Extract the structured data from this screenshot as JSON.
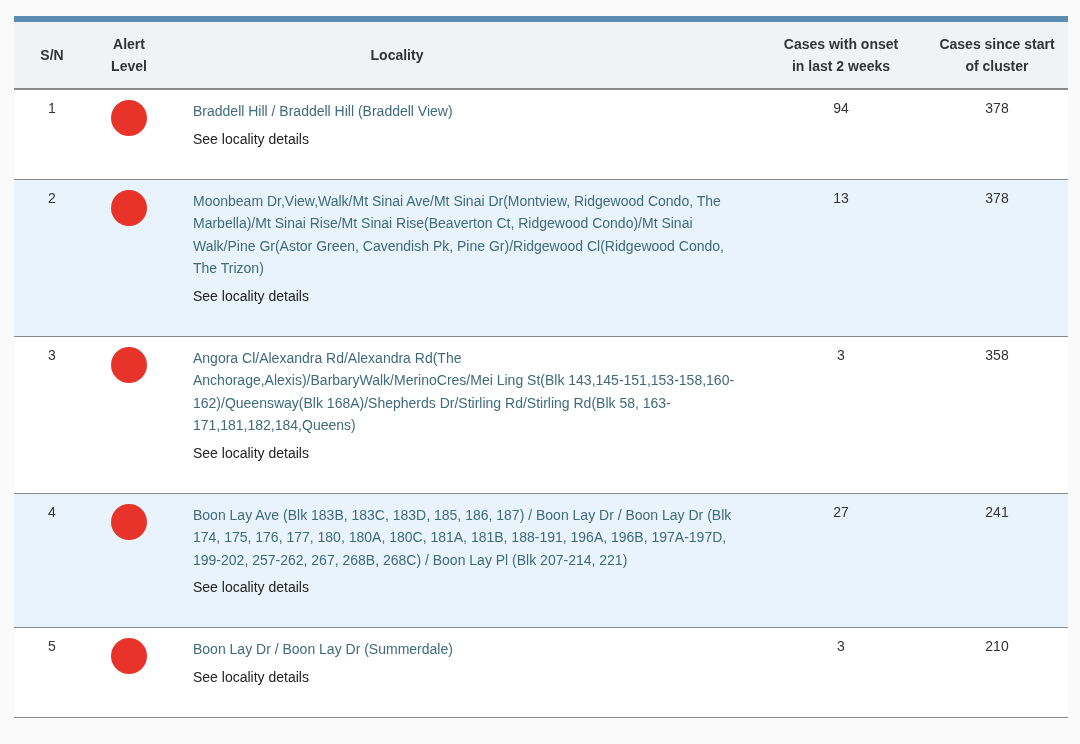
{
  "table": {
    "columns": [
      {
        "label": "S/N"
      },
      {
        "label": "Alert Level"
      },
      {
        "label": "Locality"
      },
      {
        "label": "Cases with onset in last 2 weeks"
      },
      {
        "label": "Cases since start of cluster"
      }
    ],
    "rows": [
      {
        "sn": "1",
        "color": "#e8332a",
        "locality": "Braddell Hill / Braddell Hill (Braddell View)",
        "link": "See locality details",
        "cases_2_weeks": "94",
        "cases_total": "378"
      },
      {
        "sn": "2",
        "color": "#e8332a",
        "locality": "Moonbeam Dr,View,Walk/Mt Sinai Ave/Mt Sinai Dr(Montview, Ridgewood Condo, The Marbella)/Mt Sinai Rise/Mt Sinai Rise(Beaverton Ct, Ridgewood Condo)/Mt Sinai Walk/Pine Gr(Astor Green, Cavendish Pk, Pine Gr)/Ridgewood Cl(Ridgewood Condo, The Trizon)",
        "link": "See locality details",
        "cases_2_weeks": "13",
        "cases_total": "378"
      },
      {
        "sn": "3",
        "color": "#e8332a",
        "locality": "Angora Cl/Alexandra Rd/Alexandra Rd(The Anchorage,Alexis)/BarbaryWalk/MerinoCres/Mei Ling St(Blk 143,145-151,153-158,160-162)/Queensway(Blk 168A)/Shepherds Dr/Stirling Rd/Stirling Rd(Blk 58, 163-171,181,182,184,Queens)",
        "link": "See locality details",
        "cases_2_weeks": "3",
        "cases_total": "358"
      },
      {
        "sn": "4",
        "color": "#e8332a",
        "locality": "Boon Lay Ave (Blk 183B, 183C, 183D, 185, 186, 187) / Boon Lay Dr / Boon Lay Dr (Blk 174, 175, 176, 177, 180, 180A, 180C, 181A, 181B, 188-191, 196A, 196B, 197A-197D, 199-202, 257-262, 267, 268B, 268C) / Boon Lay Pl (Blk 207-214, 221)",
        "link": "See locality details",
        "cases_2_weeks": "27",
        "cases_total": "241"
      },
      {
        "sn": "5",
        "color": "#e8332a",
        "locality": "Boon Lay Dr / Boon Lay Dr (Summerdale)",
        "link": "See locality details",
        "cases_2_weeks": "3",
        "cases_total": "210"
      }
    ]
  }
}
